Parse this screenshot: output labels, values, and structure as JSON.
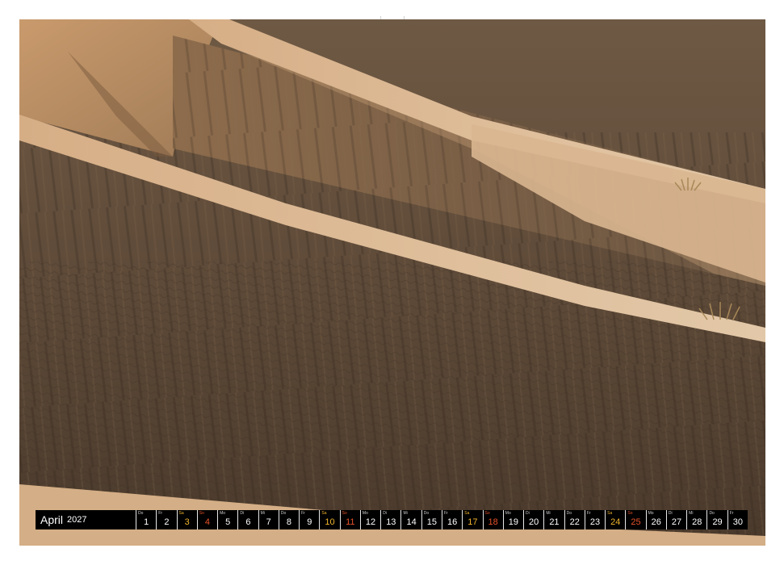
{
  "calendar": {
    "month": "April",
    "year": "2027",
    "days": [
      {
        "wd": "Do",
        "d": "1",
        "type": "week"
      },
      {
        "wd": "Fr",
        "d": "2",
        "type": "week"
      },
      {
        "wd": "Sa",
        "d": "3",
        "type": "sat"
      },
      {
        "wd": "So",
        "d": "4",
        "type": "sun"
      },
      {
        "wd": "Mo",
        "d": "5",
        "type": "week"
      },
      {
        "wd": "Di",
        "d": "6",
        "type": "week"
      },
      {
        "wd": "Mi",
        "d": "7",
        "type": "week"
      },
      {
        "wd": "Do",
        "d": "8",
        "type": "week"
      },
      {
        "wd": "Fr",
        "d": "9",
        "type": "week"
      },
      {
        "wd": "Sa",
        "d": "10",
        "type": "sat"
      },
      {
        "wd": "So",
        "d": "11",
        "type": "sun"
      },
      {
        "wd": "Mo",
        "d": "12",
        "type": "week"
      },
      {
        "wd": "Di",
        "d": "13",
        "type": "week"
      },
      {
        "wd": "Mi",
        "d": "14",
        "type": "week"
      },
      {
        "wd": "Do",
        "d": "15",
        "type": "week"
      },
      {
        "wd": "Fr",
        "d": "16",
        "type": "week"
      },
      {
        "wd": "Sa",
        "d": "17",
        "type": "sat"
      },
      {
        "wd": "So",
        "d": "18",
        "type": "sun"
      },
      {
        "wd": "Mo",
        "d": "19",
        "type": "week"
      },
      {
        "wd": "Di",
        "d": "20",
        "type": "week"
      },
      {
        "wd": "Mi",
        "d": "21",
        "type": "week"
      },
      {
        "wd": "Do",
        "d": "22",
        "type": "week"
      },
      {
        "wd": "Fr",
        "d": "23",
        "type": "week"
      },
      {
        "wd": "Sa",
        "d": "24",
        "type": "sat"
      },
      {
        "wd": "So",
        "d": "25",
        "type": "sun"
      },
      {
        "wd": "Mo",
        "d": "26",
        "type": "week"
      },
      {
        "wd": "Di",
        "d": "27",
        "type": "week"
      },
      {
        "wd": "Mi",
        "d": "28",
        "type": "week"
      },
      {
        "wd": "Do",
        "d": "29",
        "type": "week"
      },
      {
        "wd": "Fr",
        "d": "30",
        "type": "week"
      }
    ]
  },
  "colors": {
    "saturday": "#f2b52c",
    "sunday": "#e8522a",
    "bar_background": "#000000"
  },
  "photo": {
    "subject_icon": "sand-dune-photo"
  }
}
